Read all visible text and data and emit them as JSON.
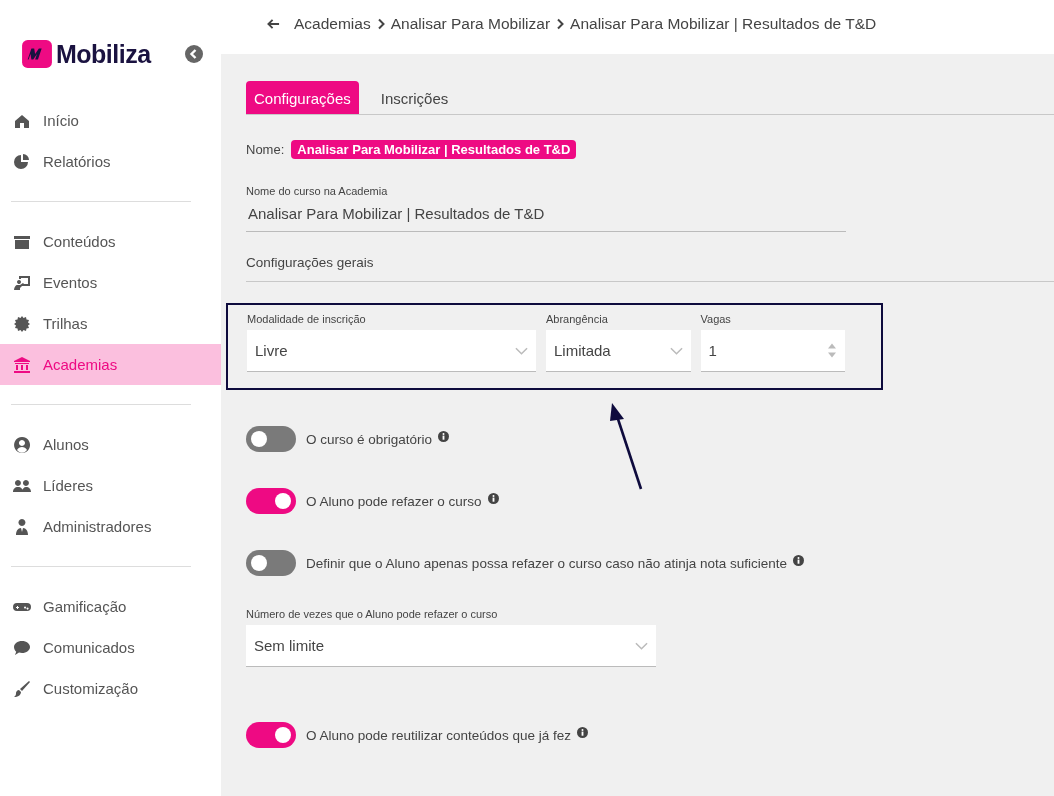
{
  "sidebar": {
    "logo": "Mobiliza",
    "groups": [
      [
        {
          "label": "Início",
          "selected": false
        },
        {
          "label": "Relatórios",
          "selected": false
        }
      ],
      [
        {
          "label": "Conteúdos",
          "selected": false
        },
        {
          "label": "Eventos",
          "selected": false
        },
        {
          "label": "Trilhas",
          "selected": false
        },
        {
          "label": "Academias",
          "selected": true
        }
      ],
      [
        {
          "label": "Alunos",
          "selected": false
        },
        {
          "label": "Líderes",
          "selected": false
        },
        {
          "label": "Administradores",
          "selected": false
        }
      ],
      [
        {
          "label": "Gamificação",
          "selected": false
        },
        {
          "label": "Comunicados",
          "selected": false
        },
        {
          "label": "Customização",
          "selected": false
        }
      ]
    ]
  },
  "breadcrumb": [
    "Academias",
    "Analisar Para Mobilizar",
    "Analisar Para Mobilizar | Resultados de T&D"
  ],
  "tabs": [
    {
      "label": "Configurações",
      "selected": true
    },
    {
      "label": "Inscrições",
      "selected": false
    }
  ],
  "name_label": "Nome:",
  "name_badge": "Analisar Para Mobilizar | Resultados de T&D",
  "course_name": {
    "label": "Nome do curso na Academia",
    "value": "Analisar Para Mobilizar | Resultados de T&D"
  },
  "section_title": "Configurações gerais",
  "enrollment": [
    {
      "kind": "select",
      "label": "Modalidade de inscrição",
      "value": "Livre"
    },
    {
      "kind": "select",
      "label": "Abrangência",
      "value": "Limitada"
    },
    {
      "kind": "number",
      "label": "Vagas",
      "value": "1"
    }
  ],
  "options": [
    {
      "kind": "toggle",
      "label": "O curso é obrigatório",
      "on": false
    },
    {
      "kind": "toggle",
      "label": "O Aluno pode refazer o curso",
      "on": true
    },
    {
      "kind": "toggle",
      "label": "Definir que o Aluno apenas possa refazer o curso caso não atinja nota suficiente",
      "on": false
    },
    {
      "kind": "select",
      "label": "Número de vezes que o Aluno pode refazer o curso",
      "value": "Sem limite"
    },
    {
      "kind": "toggle",
      "label": "O Aluno pode reutilizar conteúdos que já fez",
      "on": true
    }
  ]
}
